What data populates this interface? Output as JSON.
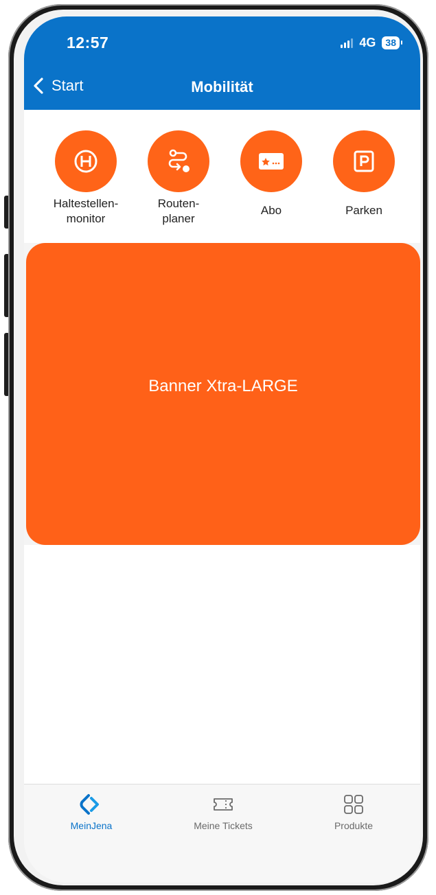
{
  "status_bar": {
    "time": "12:57",
    "network": "4G",
    "battery": "38"
  },
  "nav": {
    "back_label": "Start",
    "title": "Mobilität"
  },
  "quick_actions": [
    {
      "label_line1": "Haltestellen-",
      "label_line2": "monitor",
      "icon": "bus-stop-icon"
    },
    {
      "label_line1": "Routen-",
      "label_line2": "planer",
      "icon": "route-icon"
    },
    {
      "label_line1": "Abo",
      "label_line2": "",
      "icon": "subscription-card-icon"
    },
    {
      "label_line1": "Parken",
      "label_line2": "",
      "icon": "parking-icon"
    }
  ],
  "banner": {
    "text": "Banner Xtra-LARGE"
  },
  "tabbar": {
    "tabs": [
      {
        "label": "MeinJena",
        "icon": "meinjena-logo-icon",
        "active": true
      },
      {
        "label": "Meine Tickets",
        "icon": "ticket-icon",
        "active": false
      },
      {
        "label": "Produkte",
        "icon": "grid-icon",
        "active": false
      }
    ]
  },
  "colors": {
    "header_blue": "#0a73c9",
    "accent_orange": "#ff6418",
    "banner_orange": "#ff6118",
    "tab_inactive": "#6a6a6a"
  }
}
